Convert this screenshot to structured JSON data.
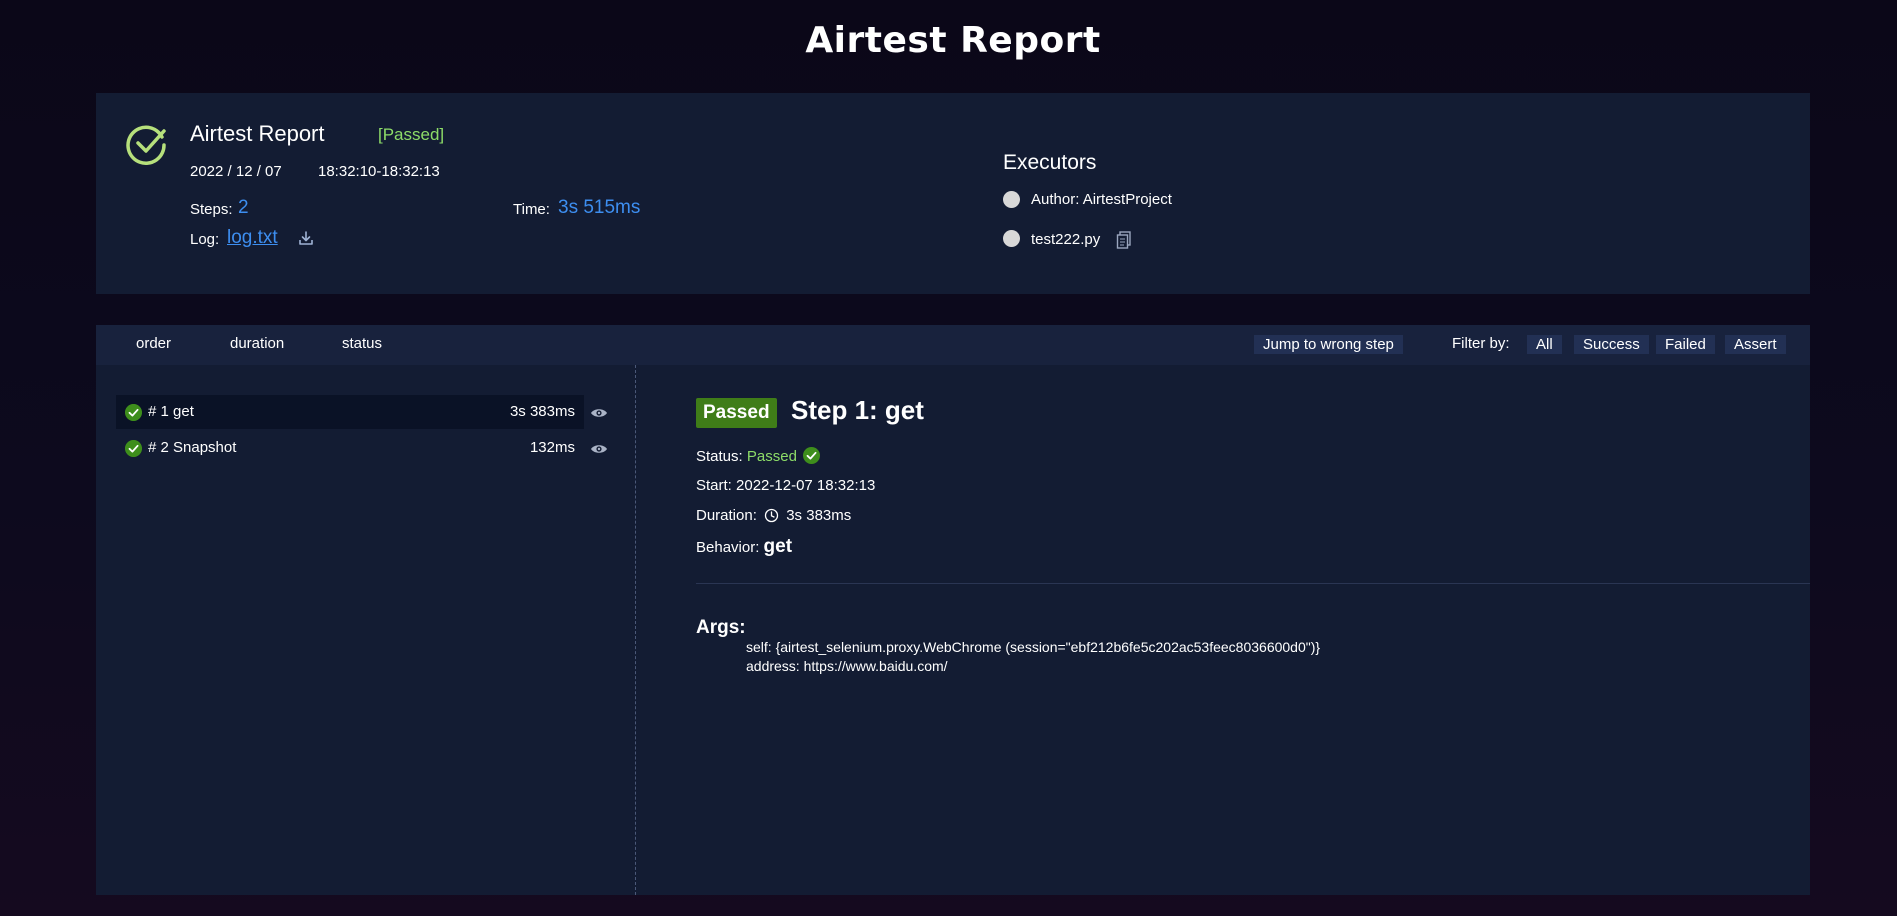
{
  "page_title": "Airtest Report",
  "summary": {
    "title": "Airtest Report",
    "result": "[Passed]",
    "date": "2022 / 12 / 07",
    "time_range": "18:32:10-18:32:13",
    "steps_label": "Steps:",
    "steps_value": "2",
    "time_label": "Time:",
    "time_value": "3s 515ms",
    "log_label": "Log:",
    "log_link": "log.txt",
    "executors_title": "Executors",
    "executors": [
      {
        "label": "Author: AirtestProject"
      },
      {
        "label": "test222.py"
      }
    ]
  },
  "toolbar": {
    "sort_order": "order",
    "sort_duration": "duration",
    "sort_status": "status",
    "jump_wrong": "Jump to wrong step",
    "filter_label": "Filter by:",
    "filter_all": "All",
    "filter_success": "Success",
    "filter_failed": "Failed",
    "filter_assert": "Assert"
  },
  "steps": [
    {
      "name": "# 1 get",
      "duration": "3s 383ms"
    },
    {
      "name": "# 2 Snapshot",
      "duration": "132ms"
    }
  ],
  "detail": {
    "badge": "Passed",
    "title": "Step 1: get",
    "status_label": "Status:",
    "status_value": "Passed",
    "start_label": "Start:",
    "start_value": "2022-12-07 18:32:13",
    "duration_label": "Duration:",
    "duration_value": "3s 383ms",
    "behavior_label": "Behavior:",
    "behavior_value": "get",
    "args_title": "Args:",
    "args": [
      "self: {airtest_selenium.proxy.WebChrome (session=\"ebf212b6fe5c202ac53feec8036600d0\")}",
      "address: https://www.baidu.com/"
    ]
  },
  "colors": {
    "accent_blue": "#3d8ef0",
    "success_green": "#8ddc68",
    "badge_green": "#3f7d18",
    "panel_bg": "#131c33"
  }
}
